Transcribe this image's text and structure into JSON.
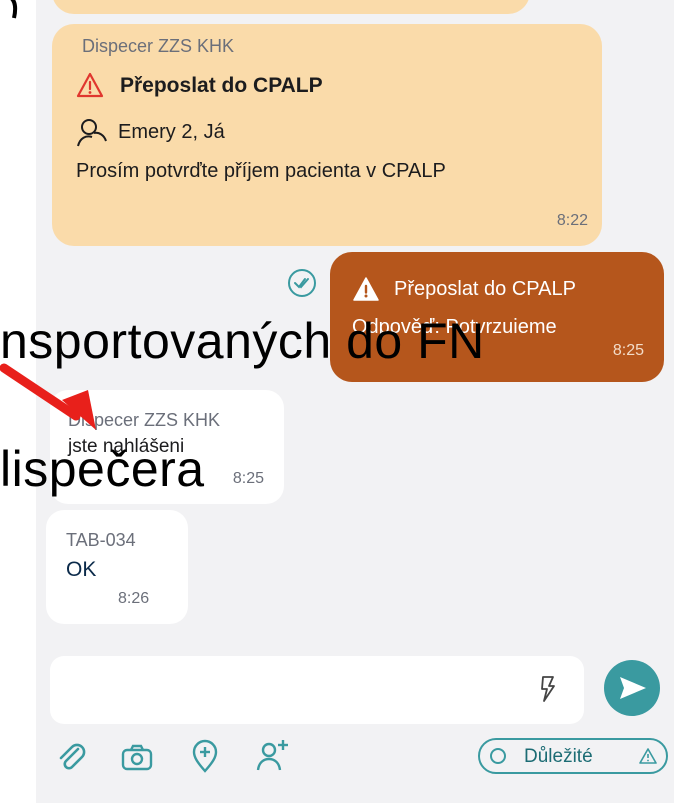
{
  "messages": {
    "first": {
      "sender": "Dispecer ZZS KHK",
      "title": "Přeposlat do CPALP",
      "recipients": "Emery 2, Já",
      "body": "Prosím potvrďte příjem pacienta v CPALP",
      "time": "8:22"
    },
    "reply": {
      "title": "Přeposlat do CPALP",
      "body": "Odpověď: Potvrzuieme",
      "time": "8:25"
    },
    "second": {
      "sender": "Dispecer ZZS KHK",
      "body": "jste nahlášeni",
      "time": "8:25"
    },
    "third": {
      "sender": "TAB-034",
      "body": "OK",
      "time": "8:26"
    }
  },
  "overlay": {
    "line1": "nsportovaných do FN",
    "line2": "lispečera"
  },
  "composer": {
    "placeholder": "",
    "important_label": "Důležité"
  },
  "colors": {
    "amber_bubble": "#fadbaa",
    "brown_bubble": "#b5561c",
    "accent_teal": "#3a9aa0",
    "warning_red": "#e0362e",
    "arrow_red": "#e8201b"
  }
}
